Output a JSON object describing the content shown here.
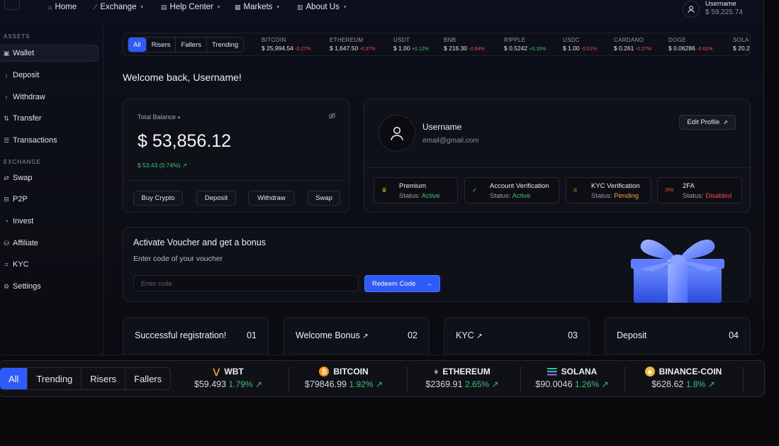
{
  "nav": {
    "items": [
      {
        "label": "Home",
        "icon": "home-icon",
        "has_chevron": false
      },
      {
        "label": "Exchange",
        "icon": "chart-line-icon",
        "has_chevron": true
      },
      {
        "label": "Help Center",
        "icon": "book-icon",
        "has_chevron": true
      },
      {
        "label": "Markets",
        "icon": "grid-icon",
        "has_chevron": true
      },
      {
        "label": "About Us",
        "icon": "info-icon",
        "has_chevron": true
      }
    ],
    "user": {
      "name": "Username",
      "balance": "$ 59,225.74"
    }
  },
  "sidebar": {
    "sections": [
      {
        "title": "ASSETS",
        "items": [
          {
            "label": "Wallet",
            "icon": "wallet-icon",
            "active": true
          },
          {
            "label": "Deposit",
            "icon": "arrow-down-icon"
          },
          {
            "label": "Withdraw",
            "icon": "arrow-up-icon"
          },
          {
            "label": "Transfer",
            "icon": "transfer-icon"
          },
          {
            "label": "Transactions",
            "icon": "list-icon"
          }
        ]
      },
      {
        "title": "EXCHANGE",
        "items": [
          {
            "label": "Swap",
            "icon": "swap-icon"
          },
          {
            "label": "P2P",
            "icon": "p2p-icon"
          },
          {
            "label": "Invest",
            "icon": "invest-icon"
          },
          {
            "label": "Affiliate",
            "icon": "affiliate-icon"
          },
          {
            "label": "KYC",
            "icon": "scan-icon"
          },
          {
            "label": "Settings",
            "icon": "gear-icon"
          }
        ]
      }
    ]
  },
  "ticker": {
    "tabs": [
      "All",
      "Risers",
      "Fallers",
      "Trending"
    ],
    "active_tab": "All",
    "coins": [
      {
        "name": "BITCOIN",
        "price": "$ 25,994.54",
        "change": "-0.27%",
        "dir": "neg"
      },
      {
        "name": "ETHEREUM",
        "price": "$ 1,647.50",
        "change": "-0.37%",
        "dir": "neg"
      },
      {
        "name": "USDT",
        "price": "$ 1.00",
        "change": "+0.12%",
        "dir": "pos"
      },
      {
        "name": "BNB",
        "price": "$ 216.30",
        "change": "-0.64%",
        "dir": "neg"
      },
      {
        "name": "RIPPLE",
        "price": "$ 0.5242",
        "change": "+0.10%",
        "dir": "pos"
      },
      {
        "name": "USDC",
        "price": "$ 1.00",
        "change": "-0.01%",
        "dir": "neg"
      },
      {
        "name": "CARDANO",
        "price": "$ 0.261",
        "change": "-0.27%",
        "dir": "neg"
      },
      {
        "name": "DOGE",
        "price": "$ 0.06286",
        "change": "-0.62%",
        "dir": "neg"
      },
      {
        "name": "SOLA",
        "price": "$ 20.2",
        "change": "",
        "dir": "neg"
      }
    ]
  },
  "welcome": "Welcome back, Username!",
  "balance_card": {
    "label": "Total Balance",
    "amount": "$ 53,856.12",
    "change": "$ 53.43 (0.74%)",
    "buttons": [
      "Buy Crypto",
      "Deposit",
      "Withdraw",
      "Swap"
    ]
  },
  "profile": {
    "name": "Username",
    "email": "email@gmail.com",
    "edit_label": "Edit Profile",
    "statuses": [
      {
        "title": "Premium",
        "prefix": "Status: ",
        "value": "Active",
        "tone": "green",
        "icon": "crown-icon"
      },
      {
        "title": "Account Verification",
        "prefix": "Status: ",
        "value": "Active",
        "tone": "green",
        "icon": "check-icon"
      },
      {
        "title": "KYC Verification",
        "prefix": "Status: ",
        "value": "Pending",
        "tone": "orange",
        "icon": "scan-icon"
      },
      {
        "title": "2FA",
        "prefix": "Status: ",
        "value": "Disabled",
        "tone": "red",
        "icon": "2fa-icon"
      }
    ]
  },
  "voucher": {
    "title": "Activate Voucher and get a bonus",
    "subtitle": "Enter code of your voucher",
    "placeholder": "Enter code",
    "button": "Redeem Code"
  },
  "steps": [
    {
      "title": "Successful registration!",
      "num": "01",
      "arrow": false
    },
    {
      "title": "Welcome Bonus",
      "num": "02",
      "arrow": true
    },
    {
      "title": "KYC",
      "num": "03",
      "arrow": true
    },
    {
      "title": "Deposit",
      "num": "04",
      "arrow": false
    }
  ],
  "bottom_ticker": {
    "tabs": [
      "All",
      "Trending",
      "Risers",
      "Fallers"
    ],
    "active_tab": "All",
    "coins": [
      {
        "name": "WBT",
        "price": "$59.493",
        "change": "1.79%",
        "icon": "wbt-icon",
        "color": "#f5a623"
      },
      {
        "name": "BITCOIN",
        "price": "$79846.99",
        "change": "1.92%",
        "icon": "bitcoin-icon",
        "color": "#f7931a"
      },
      {
        "name": "ETHEREUM",
        "price": "$2369.91",
        "change": "2.65%",
        "icon": "ethereum-icon",
        "color": "#9a9dab"
      },
      {
        "name": "SOLANA",
        "price": "$90.0046",
        "change": "1.26%",
        "icon": "solana-icon",
        "color": "#9945ff"
      },
      {
        "name": "BINANCE-COIN",
        "price": "$628.62",
        "change": "1.8%",
        "icon": "binance-icon",
        "color": "#f3ba2f"
      }
    ]
  }
}
